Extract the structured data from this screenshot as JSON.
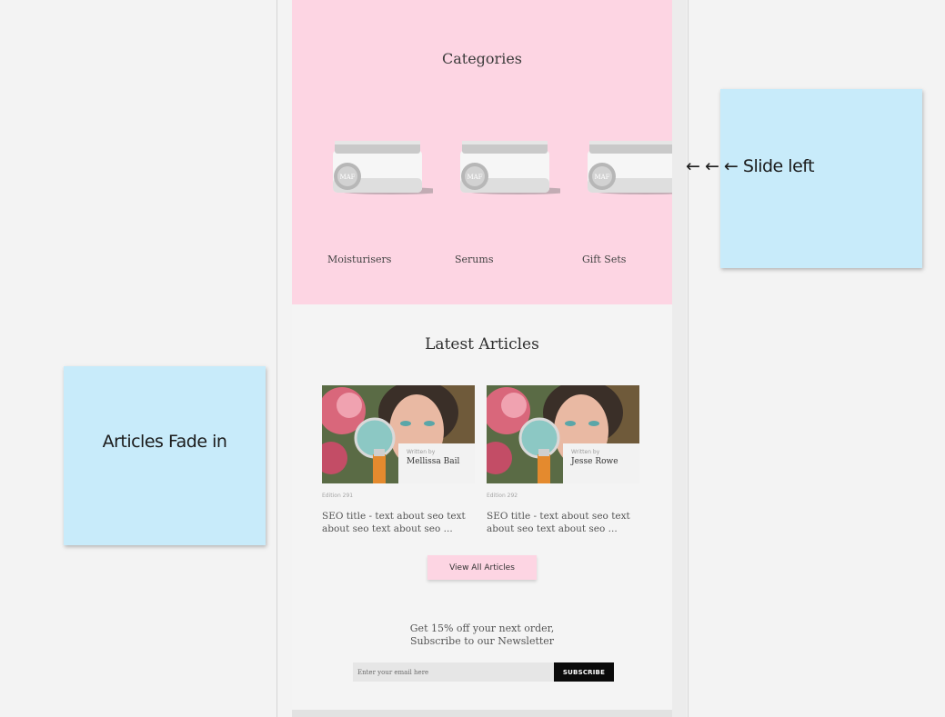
{
  "categories": {
    "title": "Categories",
    "items": [
      {
        "label": "Moisturisers",
        "jar_label": "MAF"
      },
      {
        "label": "Serums",
        "jar_label": "MAF"
      },
      {
        "label": "Gift Sets",
        "jar_label": "MAF"
      }
    ]
  },
  "articles": {
    "title": "Latest Articles",
    "items": [
      {
        "written_by": "Written by",
        "author": "Mellissa Bail",
        "edition": "Edition 291",
        "summary_line1": "SEO title - text about seo text",
        "summary_line2": "about seo text about seo ..."
      },
      {
        "written_by": "Written by",
        "author": "Jesse Rowe",
        "edition": "Edition 292",
        "summary_line1": "SEO title - text about seo text",
        "summary_line2": "about seo text about seo ..."
      }
    ],
    "view_all_label": "View All Articles"
  },
  "newsletter": {
    "line1": "Get 15% off your next order,",
    "line2": "Subscribe to our Newsletter",
    "email_placeholder": "Enter your email here",
    "subscribe_label": "SUBSCRIBE"
  },
  "annotations": {
    "fade_note": "Articles Fade in",
    "slide_note": "← ← ← Slide left"
  },
  "colors": {
    "accent_pink": "#fdd5e3",
    "note_blue": "#c8ebfa",
    "button_black": "#0a0a0a"
  }
}
